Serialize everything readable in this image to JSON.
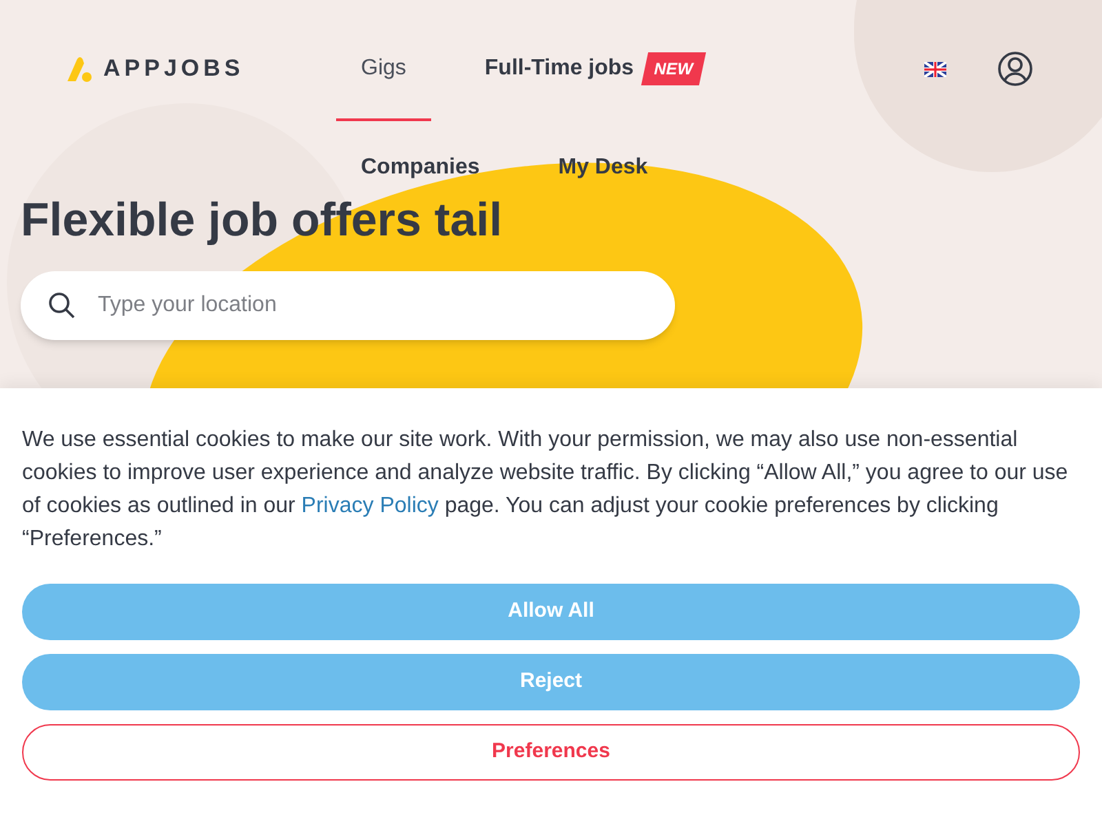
{
  "logo": {
    "text": "APPJOBS"
  },
  "nav": [
    {
      "label": "Gigs",
      "selected": true
    },
    {
      "label": "Full-Time jobs",
      "selected": false,
      "badge": "NEW"
    },
    {
      "label": "Companies",
      "selected": false
    },
    {
      "label": "My Desk",
      "selected": false
    }
  ],
  "hero": {
    "headline": "Flexible job offers tail",
    "search": {
      "placeholder": "Type your location"
    }
  },
  "cookie_banner": {
    "text": "We use essential cookies to make our site work. With your permission, we may also use non-essential cookies to improve user experience and analyze website traffic. By clicking “Allow All,” you agree to our use of cookies as outlined in our ",
    "link": "Privacy Policy",
    "text_after": " page. You can adjust your cookie preferences by clicking “Preferences.”",
    "buttons": [
      {
        "label": "Allow All",
        "kind": "filled"
      },
      {
        "label": "Reject",
        "kind": "filled"
      },
      {
        "label": "Preferences",
        "kind": "outline"
      }
    ]
  }
}
